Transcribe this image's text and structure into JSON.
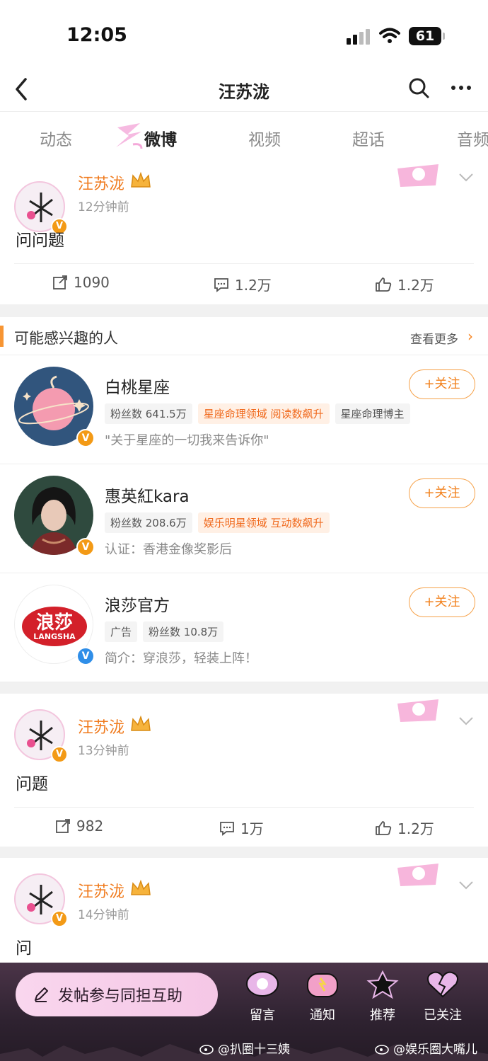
{
  "status_bar": {
    "time": "12:05",
    "battery": "61"
  },
  "nav": {
    "title": "汪苏泷"
  },
  "tabs": [
    "动态",
    "微博",
    "视频",
    "超话",
    "音频"
  ],
  "active_tab": "微博",
  "posts": [
    {
      "author": "汪苏泷",
      "time": "12分钟前",
      "text": "问问题",
      "reposts": "1090",
      "comments": "1.2万",
      "likes": "1.2万"
    },
    {
      "author": "汪苏泷",
      "time": "13分钟前",
      "text": "问题",
      "reposts": "982",
      "comments": "1万",
      "likes": "1.2万"
    },
    {
      "author": "汪苏泷",
      "time": "14分钟前",
      "text": "问"
    }
  ],
  "recommend": {
    "title": "可能感兴趣的人",
    "more": "查看更多",
    "follow_label": "+关注",
    "users": [
      {
        "name": "白桃星座",
        "chips": [
          "粉丝数 641.5万",
          "星座命理领域 阅读数飙升",
          "星座命理博主"
        ],
        "desc": "\"关于星座的一切我来告诉你\""
      },
      {
        "name": "惠英紅kara",
        "chips": [
          "粉丝数 208.6万",
          "娱乐明星领域 互动数飙升"
        ],
        "desc": "认证：香港金像奖影后"
      },
      {
        "name": "浪莎官方",
        "chips": [
          "广告",
          "粉丝数 10.8万"
        ],
        "desc": "简介：穿浪莎，轻装上阵！",
        "logo_text": "浪莎",
        "logo_sub": "LANGSHA"
      }
    ]
  },
  "bottom_bar": {
    "post_button": "发帖参与同担互助",
    "items": [
      "留言",
      "通知",
      "推荐",
      "已关注"
    ]
  },
  "watermarks": [
    "@扒圈十三姨",
    "@娱乐圈大嘴儿"
  ],
  "colors": {
    "orange": "#f07b1e",
    "accent": "#f79533",
    "bottom_bg": "#2e2230"
  }
}
